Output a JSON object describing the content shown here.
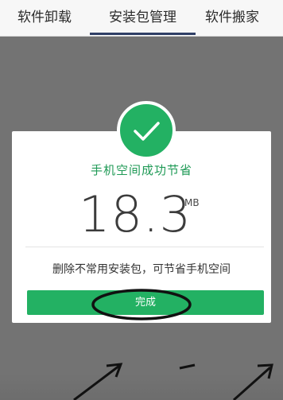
{
  "tabs": [
    {
      "label": "软件卸载"
    },
    {
      "label": "安装包管理"
    },
    {
      "label": "软件搬家"
    }
  ],
  "dialog": {
    "title": "手机空间成功节省",
    "size_value": "18.3",
    "size_unit": "MB",
    "hint": "删除不常用安装包，可节省手机空间",
    "done_label": "完成"
  },
  "colors": {
    "accent_green": "#23b163",
    "tab_indicator": "#2f3f66"
  },
  "icons": {
    "badge": "check-icon"
  }
}
